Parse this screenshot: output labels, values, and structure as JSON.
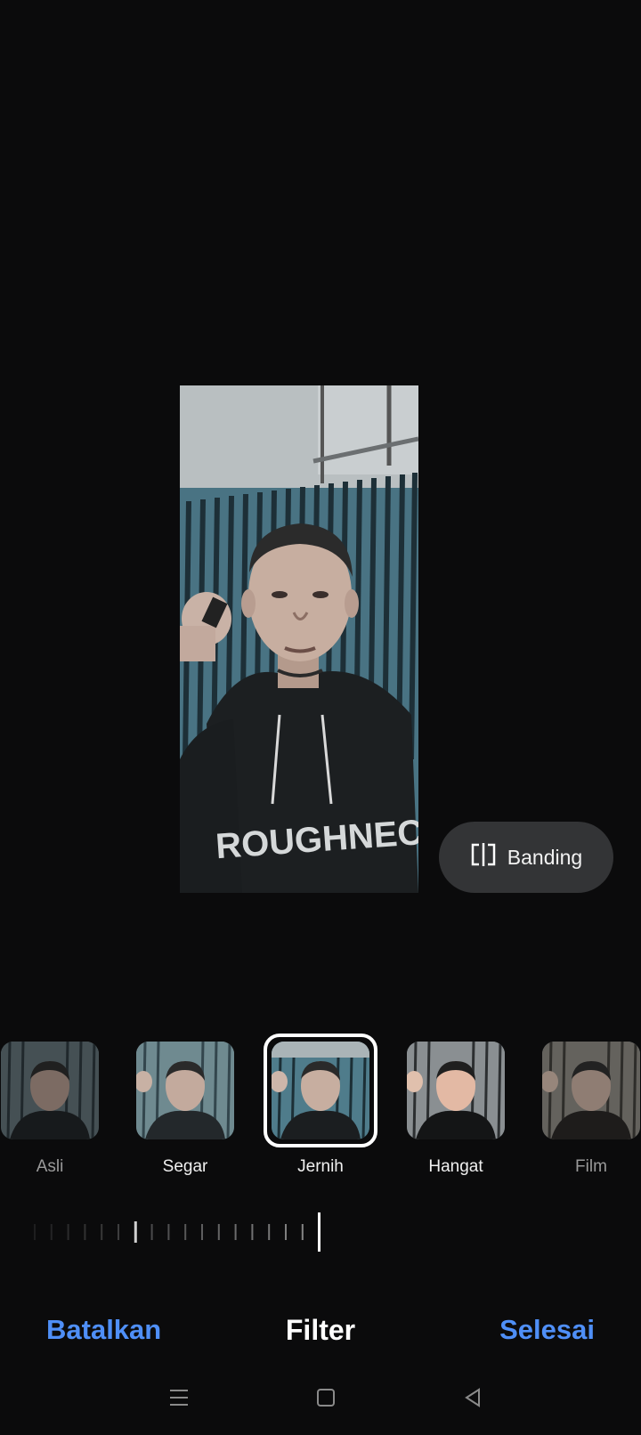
{
  "photo": {
    "shirt_text": "ROUGHNECK"
  },
  "compare": {
    "label": "Banding",
    "icon": "compare-split-icon"
  },
  "filters": [
    {
      "label": "Asli",
      "selected": false
    },
    {
      "label": "Segar",
      "selected": false
    },
    {
      "label": "Jernih",
      "selected": true
    },
    {
      "label": "Hangat",
      "selected": false
    },
    {
      "label": "Film",
      "selected": false
    }
  ],
  "intensity": {
    "value": 1.0
  },
  "bottom_bar": {
    "cancel_label": "Batalkan",
    "title": "Filter",
    "done_label": "Selesai"
  },
  "navigation": {
    "menu_icon": "menu-icon",
    "home_icon": "home-square-icon",
    "back_icon": "back-triangle-icon"
  },
  "colors": {
    "accent": "#4f8ff7",
    "background": "#0b0b0c",
    "button_bg": "#333436"
  }
}
